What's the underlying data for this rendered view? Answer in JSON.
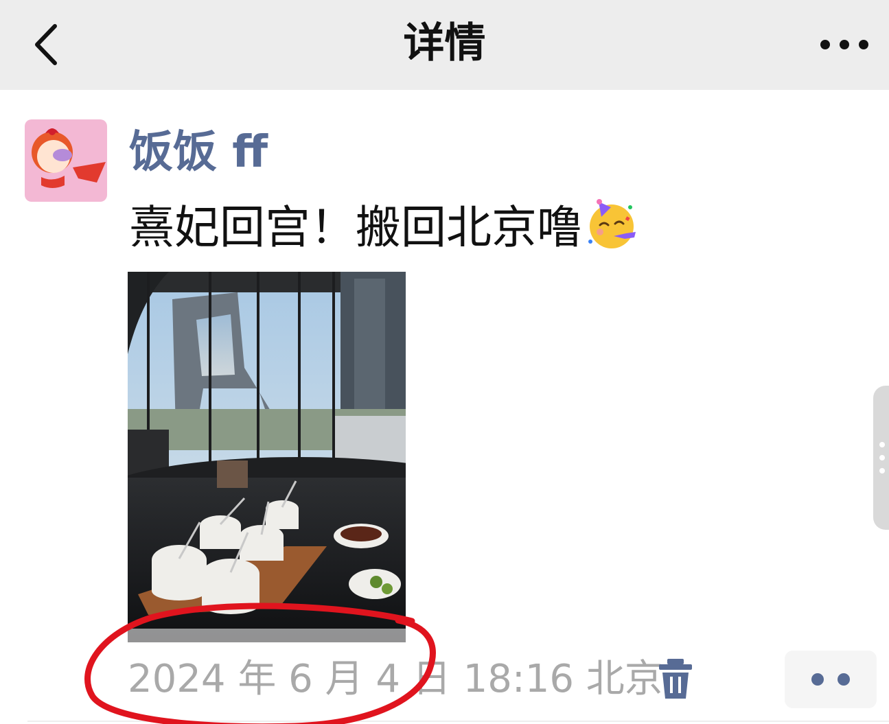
{
  "navbar": {
    "title": "详情",
    "back_icon": "chevron-left-icon",
    "more_icon": "more-dots-icon"
  },
  "post": {
    "username": "饭饭 ff",
    "text": "熹妃回宫！搬回北京噜",
    "emoji_icon": "partying-face-icon",
    "photo_description_icon": "photo-thumbnail",
    "timestamp": "2024 年 6 月 4 日 18:16",
    "location": "北京",
    "delete_icon": "trash-icon",
    "action_icon": "two-dots-icon"
  },
  "colors": {
    "navbar_bg": "#ededed",
    "username": "#576b95",
    "timestamp": "#a9a9a9",
    "annotation": "#e0141e"
  }
}
